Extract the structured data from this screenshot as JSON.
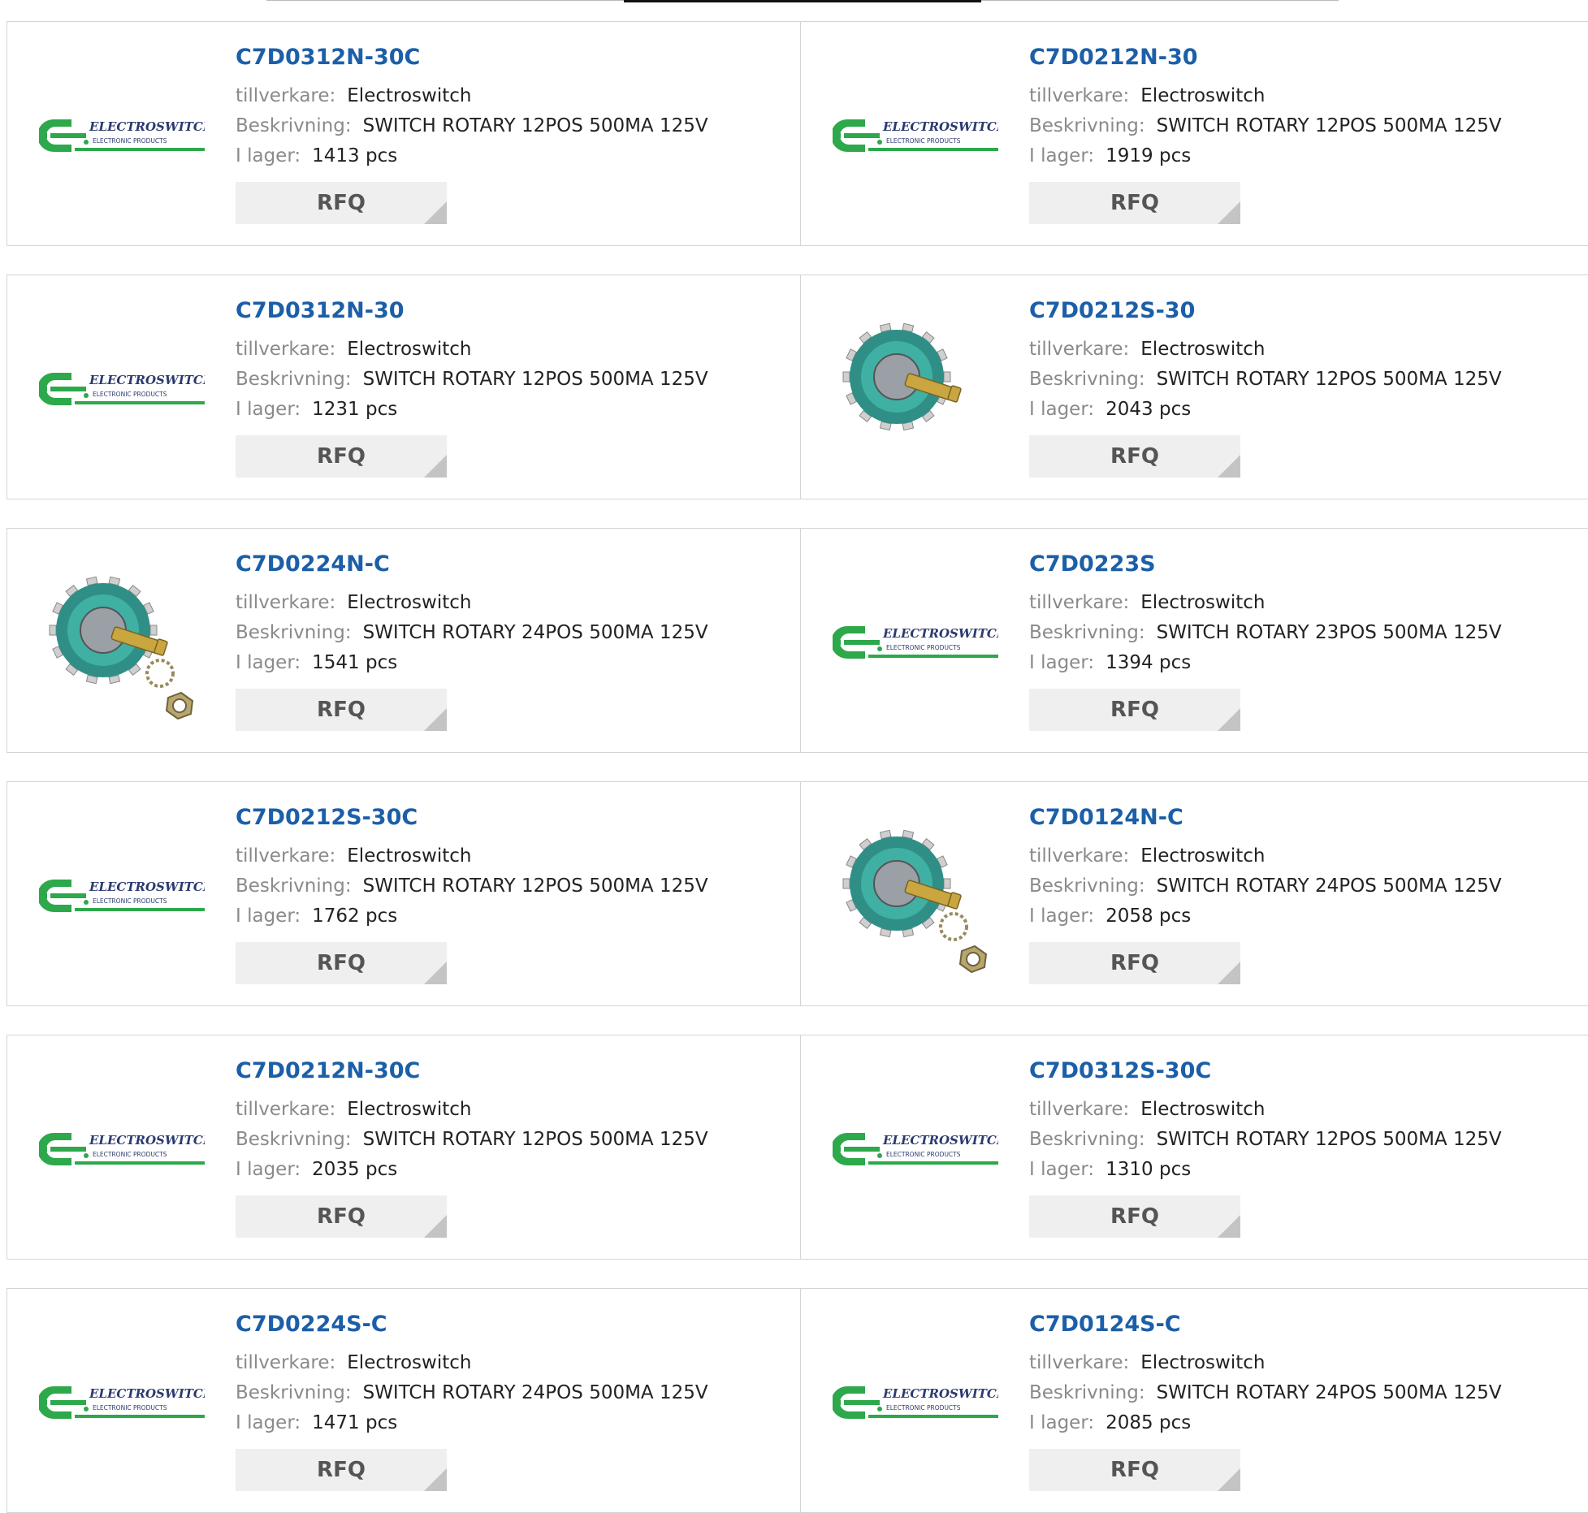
{
  "labels": {
    "manufacturer": "tillverkare:",
    "description": "Beskrivning:",
    "stock": "I lager:",
    "rfq": "RFQ"
  },
  "logo": {
    "brand": "ELECTROSWITCH",
    "tagline": "ELECTRONIC PRODUCTS",
    "color": "#2da84a"
  },
  "colors": {
    "part_number": "#1c5fa8",
    "button_bg": "#efefef"
  },
  "products": [
    {
      "part": "C7D0312N-30C",
      "manufacturer": "Electroswitch",
      "description": "SWITCH ROTARY 12POS 500MA 125V",
      "stock": "1413 pcs",
      "image": "logo"
    },
    {
      "part": "C7D0212N-30",
      "manufacturer": "Electroswitch",
      "description": "SWITCH ROTARY 12POS 500MA 125V",
      "stock": "1919 pcs",
      "image": "logo"
    },
    {
      "part": "C7D0312N-30",
      "manufacturer": "Electroswitch",
      "description": "SWITCH ROTARY 12POS 500MA 125V",
      "stock": "1231 pcs",
      "image": "logo"
    },
    {
      "part": "C7D0212S-30",
      "manufacturer": "Electroswitch",
      "description": "SWITCH ROTARY 12POS 500MA 125V",
      "stock": "2043 pcs",
      "image": "rotary-switch-photo"
    },
    {
      "part": "C7D0224N-C",
      "manufacturer": "Electroswitch",
      "description": "SWITCH ROTARY 24POS 500MA 125V",
      "stock": "1541 pcs",
      "image": "rotary-switch-with-hardware-photo"
    },
    {
      "part": "C7D0223S",
      "manufacturer": "Electroswitch",
      "description": "SWITCH ROTARY 23POS 500MA 125V",
      "stock": "1394 pcs",
      "image": "logo"
    },
    {
      "part": "C7D0212S-30C",
      "manufacturer": "Electroswitch",
      "description": "SWITCH ROTARY 12POS 500MA 125V",
      "stock": "1762 pcs",
      "image": "logo"
    },
    {
      "part": "C7D0124N-C",
      "manufacturer": "Electroswitch",
      "description": "SWITCH ROTARY 24POS 500MA 125V",
      "stock": "2058 pcs",
      "image": "rotary-switch-with-hardware-photo"
    },
    {
      "part": "C7D0212N-30C",
      "manufacturer": "Electroswitch",
      "description": "SWITCH ROTARY 12POS 500MA 125V",
      "stock": "2035 pcs",
      "image": "logo"
    },
    {
      "part": "C7D0312S-30C",
      "manufacturer": "Electroswitch",
      "description": "SWITCH ROTARY 12POS 500MA 125V",
      "stock": "1310 pcs",
      "image": "logo"
    },
    {
      "part": "C7D0224S-C",
      "manufacturer": "Electroswitch",
      "description": "SWITCH ROTARY 24POS 500MA 125V",
      "stock": "1471 pcs",
      "image": "logo"
    },
    {
      "part": "C7D0124S-C",
      "manufacturer": "Electroswitch",
      "description": "SWITCH ROTARY 24POS 500MA 125V",
      "stock": "2085 pcs",
      "image": "logo"
    }
  ]
}
